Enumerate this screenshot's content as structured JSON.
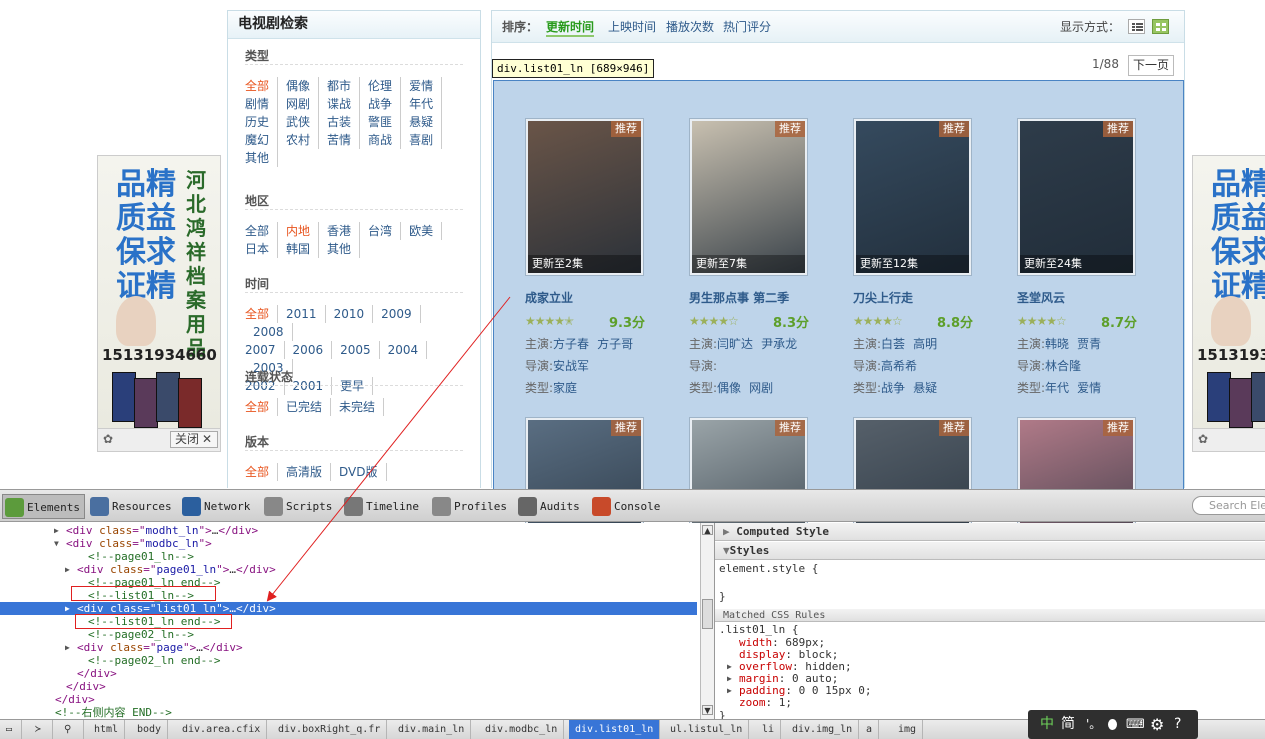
{
  "filter": {
    "title": "电视剧检索",
    "groups": [
      {
        "title": "类型",
        "rows": [
          [
            "全部",
            "偶像",
            "都市",
            "伦理",
            "爱情"
          ],
          [
            "剧情",
            "网剧",
            "谍战",
            "战争",
            "年代"
          ],
          [
            "历史",
            "武侠",
            "古装",
            "警匪",
            "悬疑"
          ],
          [
            "魔幻",
            "农村",
            "苦情",
            "商战",
            "喜剧"
          ],
          [
            "其他"
          ]
        ],
        "selected": "全部"
      },
      {
        "title": "地区",
        "rows": [
          [
            "全部",
            "内地",
            "香港",
            "台湾",
            "欧美"
          ],
          [
            "日本",
            "韩国",
            "其他"
          ]
        ],
        "selected": "内地"
      },
      {
        "title": "时间",
        "rows": [
          [
            "全部",
            "2011",
            "2010",
            "2009",
            "2008"
          ],
          [
            "2007",
            "2006",
            "2005",
            "2004",
            "2003"
          ],
          [
            "2002",
            "2001",
            "更早"
          ]
        ],
        "selected": "全部"
      },
      {
        "title": "连载状态",
        "rows": [
          [
            "全部",
            "已完结",
            "未完结"
          ]
        ],
        "selected": "全部"
      },
      {
        "title": "版本",
        "rows": [
          [
            "全部",
            "高清版",
            "DVD版"
          ]
        ],
        "selected": "全部"
      }
    ]
  },
  "sort": {
    "label": "排序：",
    "items": [
      "更新时间",
      "上映时间",
      "播放次数",
      "热门评分"
    ],
    "active": "更新时间",
    "display_label": "显示方式：",
    "page": "1/88",
    "next": "下一页"
  },
  "tooltip": "div.list01_ln [689×946]",
  "cards": [
    {
      "title": "成家立业",
      "badge": "推荐",
      "update": "更新至2集",
      "stars": 4.5,
      "score": "9.3分",
      "cast_label": "主演:",
      "cast": [
        "方子春",
        "方子哥"
      ],
      "director_label": "导演:",
      "director": [
        "安战军"
      ],
      "genre_label": "类型:",
      "genre": [
        "家庭"
      ],
      "poster_color": "#6a5548"
    },
    {
      "title": "男生那点事 第二季",
      "badge": "推荐",
      "update": "更新至7集",
      "stars": 4,
      "score": "8.3分",
      "cast_label": "主演:",
      "cast": [
        "闫旷达",
        "尹承龙"
      ],
      "director_label": "导演:",
      "director": [],
      "genre_label": "类型:",
      "genre": [
        "偶像",
        "网剧"
      ],
      "poster_color": "#c8c0b0"
    },
    {
      "title": "刀尖上行走",
      "badge": "推荐",
      "update": "更新至12集",
      "stars": 4,
      "score": "8.8分",
      "cast_label": "主演:",
      "cast": [
        "白荟",
        "高明"
      ],
      "director_label": "导演:",
      "director": [
        "高希希"
      ],
      "genre_label": "类型:",
      "genre": [
        "战争",
        "悬疑"
      ],
      "poster_color": "#354a5e"
    },
    {
      "title": "圣堂风云",
      "badge": "推荐",
      "update": "更新至24集",
      "stars": 4,
      "score": "8.7分",
      "cast_label": "主演:",
      "cast": [
        "韩晓",
        "贾青"
      ],
      "director_label": "导演:",
      "director": [
        "林合隆"
      ],
      "genre_label": "类型:",
      "genre": [
        "年代",
        "爱情"
      ],
      "poster_color": "#2e3c4a"
    },
    {
      "badge": "推荐",
      "poster_color": "#5a6e82"
    },
    {
      "badge": "推荐",
      "poster_color": "#9aa4a8"
    },
    {
      "badge": "推荐",
      "poster_color": "#56606a"
    },
    {
      "badge": "推荐",
      "poster_color": "#b07a88"
    }
  ],
  "ad": {
    "big_text": [
      "品精",
      "质益",
      "保求",
      "证精"
    ],
    "side_text": "河北鸿祥档案用品",
    "phone": "15131934660",
    "close_label": "关闭",
    "close_icon": "✕"
  },
  "devtools": {
    "tabs": [
      {
        "label": "Elements",
        "icon": "elements-icon",
        "color": "#5c9b3c"
      },
      {
        "label": "Resources",
        "icon": "resources-icon",
        "color": "#4a6fa0"
      },
      {
        "label": "Network",
        "icon": "network-icon",
        "color": "#2b5f9e"
      },
      {
        "label": "Scripts",
        "icon": "scripts-icon",
        "color": "#888"
      },
      {
        "label": "Timeline",
        "icon": "timeline-icon",
        "color": "#777"
      },
      {
        "label": "Profiles",
        "icon": "profiles-icon",
        "color": "#888"
      },
      {
        "label": "Audits",
        "icon": "audits-icon",
        "color": "#666"
      },
      {
        "label": "Console",
        "icon": "console-icon",
        "color": "#c84a2a"
      }
    ],
    "search_placeholder": "Search Elements",
    "dom_lines": [
      {
        "indent": 6,
        "arrow": "▶",
        "html": [
          [
            "tg",
            "<div "
          ],
          [
            "at",
            "class"
          ],
          [
            "tg",
            "=\""
          ],
          [
            "av",
            "modht_ln"
          ],
          [
            "tg",
            "\">"
          ],
          [
            "",
            "…"
          ],
          [
            "tg",
            "</div>"
          ]
        ]
      },
      {
        "indent": 6,
        "arrow": "▼",
        "html": [
          [
            "tg",
            "<div "
          ],
          [
            "at",
            "class"
          ],
          [
            "tg",
            "=\""
          ],
          [
            "av",
            "modbc_ln"
          ],
          [
            "tg",
            "\">"
          ]
        ]
      },
      {
        "indent": 8,
        "arrow": "",
        "html": [
          [
            "cm",
            "<!--page01_ln-->"
          ]
        ]
      },
      {
        "indent": 7,
        "arrow": "▶",
        "html": [
          [
            "tg",
            "<div "
          ],
          [
            "at",
            "class"
          ],
          [
            "tg",
            "=\""
          ],
          [
            "av",
            "page01_ln"
          ],
          [
            "tg",
            "\">"
          ],
          [
            "",
            "…"
          ],
          [
            "tg",
            "</div>"
          ]
        ]
      },
      {
        "indent": 8,
        "arrow": "",
        "html": [
          [
            "cm",
            "<!--page01_ln end-->"
          ]
        ]
      },
      {
        "indent": 8,
        "arrow": "",
        "html": [
          [
            "cm",
            "<!--list01_ln-->"
          ]
        ]
      },
      {
        "indent": 7,
        "arrow": "▶",
        "sel": true,
        "html": [
          [
            "tg",
            "<div "
          ],
          [
            "at",
            "class"
          ],
          [
            "tg",
            "=\""
          ],
          [
            "av",
            "list01_ln"
          ],
          [
            "tg",
            "\">"
          ],
          [
            "",
            "…"
          ],
          [
            "tg",
            "</div>"
          ]
        ]
      },
      {
        "indent": 8,
        "arrow": "",
        "html": [
          [
            "cm",
            "<!--list01_ln end-->"
          ]
        ]
      },
      {
        "indent": 8,
        "arrow": "",
        "html": [
          [
            "cm",
            "<!--page02_ln-->"
          ]
        ]
      },
      {
        "indent": 7,
        "arrow": "▶",
        "html": [
          [
            "tg",
            "<div "
          ],
          [
            "at",
            "class"
          ],
          [
            "tg",
            "=\""
          ],
          [
            "av",
            "page"
          ],
          [
            "tg",
            "\">"
          ],
          [
            "",
            "…"
          ],
          [
            "tg",
            "</div>"
          ]
        ]
      },
      {
        "indent": 8,
        "arrow": "",
        "html": [
          [
            "cm",
            "<!--page02_ln end-->"
          ]
        ]
      },
      {
        "indent": 7,
        "arrow": "",
        "html": [
          [
            "tg",
            "</div>"
          ]
        ]
      },
      {
        "indent": 6,
        "arrow": "",
        "html": [
          [
            "tg",
            "</div>"
          ]
        ]
      },
      {
        "indent": 5,
        "arrow": "",
        "html": [
          [
            "tg",
            "</div>"
          ]
        ]
      },
      {
        "indent": 5,
        "arrow": "",
        "html": [
          [
            "cm",
            "<!--右侧内容 END-->"
          ]
        ]
      }
    ],
    "computed_style": "Computed Style",
    "styles": "Styles",
    "element_style": "element.style {",
    "close_brace": "}",
    "matched": "Matched CSS Rules",
    "rule_selector": ".list01_ln {",
    "rules": [
      {
        "arrow": "",
        "name": "width",
        "value": "689px;"
      },
      {
        "arrow": "",
        "name": "display",
        "value": "block;"
      },
      {
        "arrow": "▶",
        "name": "overflow",
        "value": "hidden;"
      },
      {
        "arrow": "▶",
        "name": "margin",
        "value": "0 auto;"
      },
      {
        "arrow": "▶",
        "name": "padding",
        "value": "0 0 15px 0;"
      },
      {
        "arrow": "",
        "name": "zoom",
        "value": "1;"
      }
    ],
    "breadcrumbs": [
      "html",
      "body",
      "div.area.cfix",
      "div.boxRight_q.fr",
      "div.main_ln",
      "div.modbc_ln",
      "div.list01_ln",
      "ul.listul_ln",
      "li",
      "div.img_ln",
      "a",
      "img"
    ],
    "active_crumb": "div.list01_ln"
  },
  "ime": {
    "label1": "中",
    "label2": "简"
  }
}
